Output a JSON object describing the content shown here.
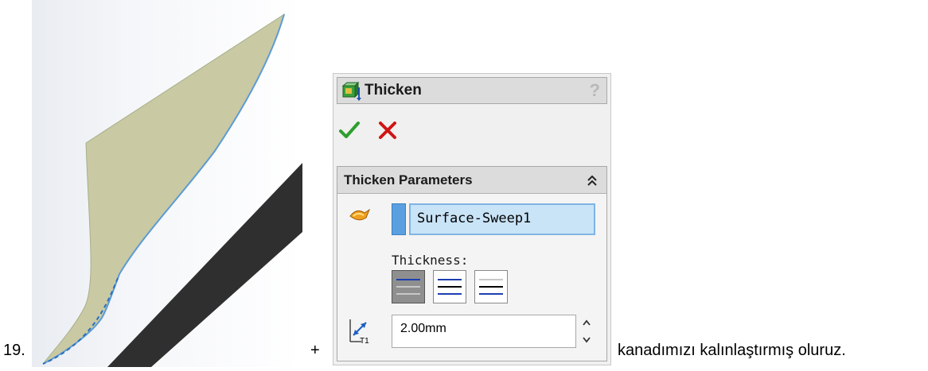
{
  "step": {
    "number": "19."
  },
  "plus": "+",
  "trailing_text": "kanadımızı kalınlaştırmış oluruz.",
  "property_manager": {
    "title": "Thicken",
    "help": "?",
    "group": {
      "title": "Thicken Parameters",
      "selection": "Surface-Sweep1",
      "thickness_label": "Thickness:",
      "thickness_value": "2.00mm",
      "direction_options": [
        {
          "name": "thicken-side-1",
          "active": true
        },
        {
          "name": "thicken-both-sides",
          "active": false
        },
        {
          "name": "thicken-side-2",
          "active": false
        }
      ]
    }
  },
  "colors": {
    "wing_face": "#c9c9a3",
    "wing_edge": "#5b9bd5",
    "shadow": "#333333",
    "ok": "#2e9e2e",
    "cancel": "#d11414",
    "selection_fill": "#c9e3f7"
  },
  "icons": {
    "thicken": "thicken-feature-icon",
    "ok": "checkmark-icon",
    "cancel": "x-icon",
    "collapse": "double-chevron-up-icon",
    "face": "face-selection-icon",
    "thickness_dim": "t1-dimension-icon"
  }
}
